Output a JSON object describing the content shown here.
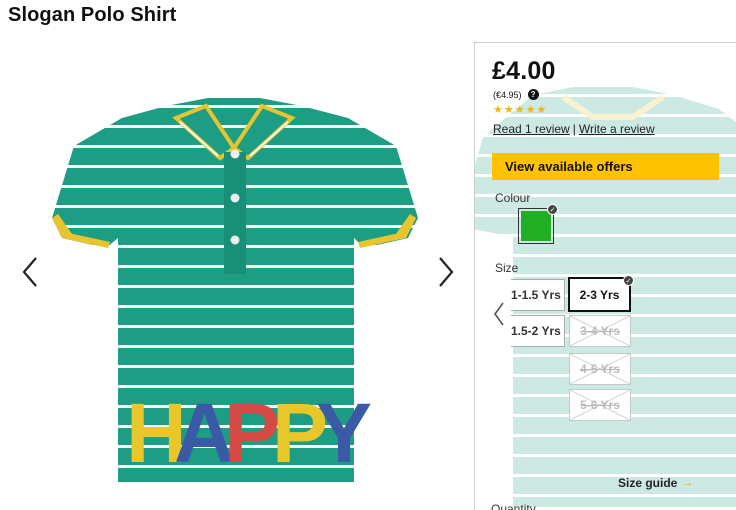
{
  "product": {
    "title": "Slogan Polo Shirt",
    "price": "£4.00",
    "price_eur": "(€4.95)",
    "rating_stars": 5,
    "read_review": "Read 1 review",
    "review_separator": "|",
    "write_review": "Write a review",
    "offers_button": "View available offers"
  },
  "colour": {
    "label": "Colour",
    "selected_hex": "#1fae24"
  },
  "size": {
    "label": "Size",
    "options": [
      {
        "label": "1-1.5 Yrs",
        "available": true,
        "selected": false
      },
      {
        "label": "2-3 Yrs",
        "available": true,
        "selected": true
      },
      {
        "label": "1.5-2 Yrs",
        "available": true,
        "selected": false
      },
      {
        "label": "3-4 Yrs",
        "available": false,
        "selected": false
      },
      {
        "label": "4-5 Yrs",
        "available": false,
        "selected": false
      },
      {
        "label": "5-6 Yrs",
        "available": false,
        "selected": false
      }
    ],
    "guide": "Size guide"
  },
  "quantity": {
    "label": "Quantity"
  },
  "image": {
    "slogan": "HAPPY",
    "shirt_colour": "#1d9e84",
    "collar_trim": "#e8c52e",
    "slogan_colours": [
      "#e7c72a",
      "#3a5aa6",
      "#d54a45",
      "#e7c72a",
      "#3a5aa6"
    ]
  },
  "icons": {
    "prev": "chevron-left-icon",
    "next": "chevron-right-icon",
    "help": "question-circle-icon",
    "star": "star-icon",
    "check": "check-badge-icon"
  }
}
